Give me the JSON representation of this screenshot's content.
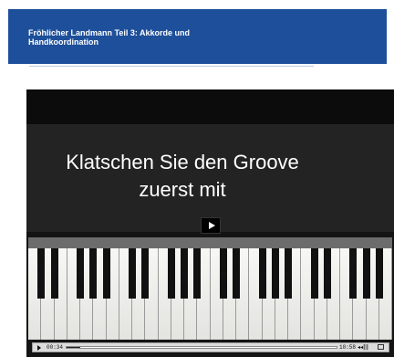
{
  "header": {
    "title_line1": "Fröhlicher Landmann Teil 3: Akkorde und",
    "title_line2": "Handkoordination"
  },
  "video": {
    "overlay_line1": "Klatschen Sie den Groove",
    "overlay_line2": "zuerst mit",
    "play_icon": "play-icon",
    "controls": {
      "elapsed": "00:34",
      "total": "10:58",
      "progress": 0.05,
      "volume_icon": "volume-icon",
      "fullscreen_icon": "fullscreen-icon"
    }
  },
  "colors": {
    "header_bg": "#1e4f9a",
    "header_text": "#ffffff",
    "video_bg": "#141414"
  }
}
